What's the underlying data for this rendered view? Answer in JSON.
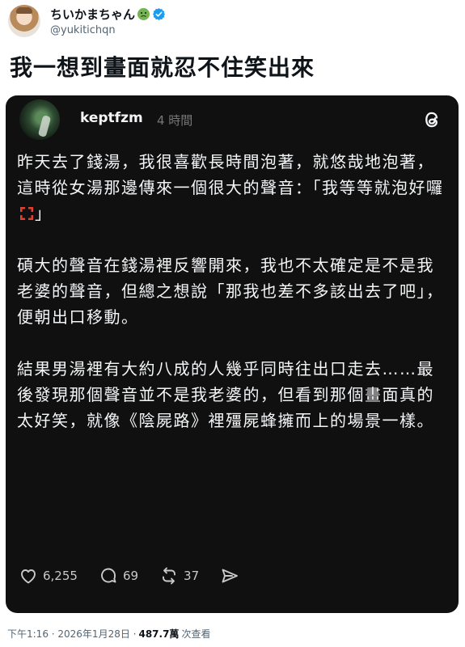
{
  "tweet": {
    "author": {
      "display_name": "ちいかまちゃん",
      "name_emoji": "nauseated-face",
      "verified": true,
      "handle": "@yukitichqn"
    },
    "text": "我一想到畫面就忍不住笑出來"
  },
  "quoted_post": {
    "platform": "threads",
    "username": "keptfzm",
    "time": "4 時間",
    "paragraphs": [
      [
        "昨天去了錢湯，我很喜歡長時間泡著，就悠哉地泡著，這時從女湯那邊傳來一個很大的聲音：「我等等就泡好囉",
        "anger-symbol",
        "」"
      ],
      [
        "碩大的聲音在錢湯裡反響開來，我也不太確定是不是我老婆的聲音，但總之想說「那我也差不多該出去了吧」，便朝出口移動。"
      ],
      [
        "結果男湯裡有大約八成的人幾乎同時往出口走去……最後發現那個聲音並不是我老婆的，但看到那個畫面真的太好笑，就像《陰屍路》裡殭屍蜂擁而上的場景一樣。"
      ]
    ],
    "actions": {
      "likes": "6,255",
      "replies": "69",
      "reposts": "37"
    }
  },
  "footer": {
    "timestamp": "下午1:16 · 2026年1月28日 ·",
    "views_count": "487.7萬",
    "views_label": "次查看"
  },
  "colors": {
    "card_background": "#101010",
    "card_text": "#f3f5f7",
    "verified_blue": "#1d9bf0",
    "muted_gray": "#536471"
  }
}
